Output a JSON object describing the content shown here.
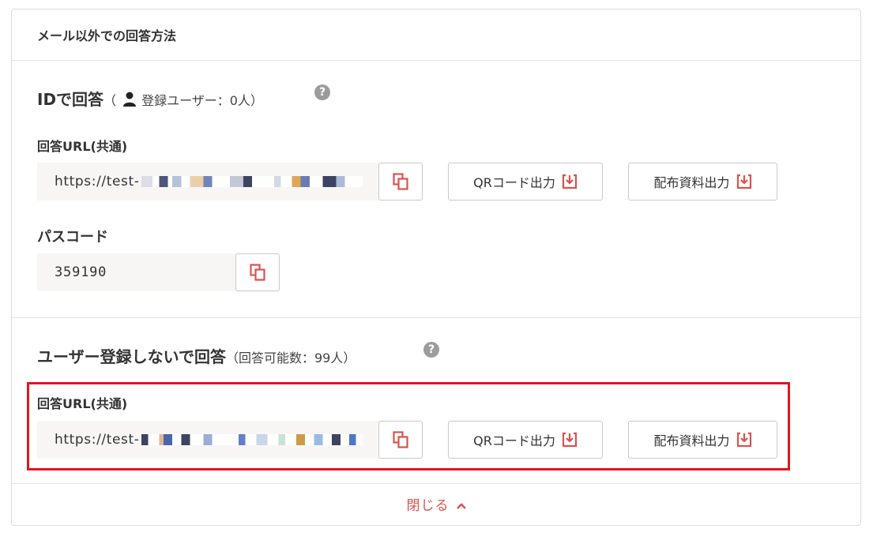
{
  "panel": {
    "title": "メール以外での回答方法"
  },
  "id_section": {
    "title": "IDで回答",
    "paren_open": "（",
    "registered_label": "登録ユーザー：0人",
    "paren_close": "）",
    "help": "?",
    "url_label": "回答URL(共通)",
    "url_value": "https://test-",
    "passcode_label": "パスコード",
    "passcode_value": "359190"
  },
  "noreg_section": {
    "title": "ユーザー登録しないで回答",
    "capacity": "（回答可能数：99人）",
    "help": "?",
    "url_label": "回答URL(共通)",
    "url_value": "https://test-"
  },
  "buttons": {
    "qr_label": "QRコード出力",
    "dist_label": "配布資料出力"
  },
  "footer": {
    "close_label": "閉じる"
  },
  "colors": {
    "accent": "#d9534f",
    "highlight": "#e0161d"
  }
}
